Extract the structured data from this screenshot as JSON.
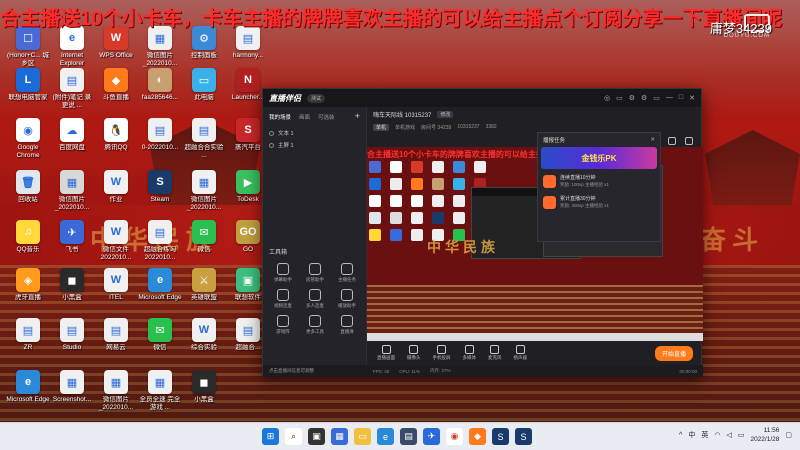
{
  "overlay": {
    "marquee": "合主播送10个小卡车，卡车主播的牌牌喜欢主播的可以给主播点个订阅分享一下直播间呢",
    "watermark": "庸梦34239",
    "brand": "DOUYU.COM"
  },
  "desktop": {
    "background_banner": "中华民族",
    "background_banner_right": "奋斗",
    "icons": [
      {
        "label": "(Honor+C... 城乡区",
        "color": "#4a6ad8",
        "glyph": "☐"
      },
      {
        "label": "Internet Explorer",
        "color": "#ffffff",
        "glyph": "e"
      },
      {
        "label": "WPS Office",
        "color": "#d83a2a",
        "glyph": "W"
      },
      {
        "label": "微信图片_2022010...",
        "color": "#f0f0f0",
        "glyph": "▦"
      },
      {
        "label": "控制面板",
        "color": "#3a8ad8",
        "glyph": "⚙"
      },
      {
        "label": "harmony...",
        "color": "#f0f0f0",
        "glyph": "▤"
      },
      {
        "label": "联想电脑管家",
        "color": "#1a6ad8",
        "glyph": "L"
      },
      {
        "label": "(附件)笔记 录 更说 ...",
        "color": "#f0f0f0",
        "glyph": "▤"
      },
      {
        "label": "斗鱼直播",
        "color": "#ff7a1a",
        "glyph": "◆"
      },
      {
        "label": "faa285646...",
        "color": "#c8a070",
        "glyph": "◐"
      },
      {
        "label": "此电脑",
        "color": "#3ab0e8",
        "glyph": "▭"
      },
      {
        "label": "Launcher...",
        "color": "#b02020",
        "glyph": "N"
      },
      {
        "label": "Google Chrome",
        "color": "#ffffff",
        "glyph": "◉"
      },
      {
        "label": "百度网盘",
        "color": "#ffffff",
        "glyph": "☁"
      },
      {
        "label": "腾讯QQ",
        "color": "#ffffff",
        "glyph": "🐧"
      },
      {
        "label": "0-2022010...",
        "color": "#f0f0f0",
        "glyph": "▤"
      },
      {
        "label": "超融合合实验 ...",
        "color": "#f0f0f0",
        "glyph": "▤"
      },
      {
        "label": "蒸汽平台",
        "color": "#c8282a",
        "glyph": "S"
      },
      {
        "label": "回收站",
        "color": "#e0e6ee",
        "glyph": "🗑"
      },
      {
        "label": "微信图片_2022010...",
        "color": "#d8d8d8",
        "glyph": "▦"
      },
      {
        "label": "作业",
        "color": "#f0f0f0",
        "glyph": "W"
      },
      {
        "label": "Steam",
        "color": "#1a3a6a",
        "glyph": "S"
      },
      {
        "label": "微信图片_2022010...",
        "color": "#f0f0f0",
        "glyph": "▦"
      },
      {
        "label": "ToDesk",
        "color": "#3ac060",
        "glyph": "▶"
      },
      {
        "label": "QQ音乐",
        "color": "#ffd83a",
        "glyph": "♫"
      },
      {
        "label": "飞书",
        "color": "#3a6ad8",
        "glyph": "✈"
      },
      {
        "label": "微信文件 2022010...",
        "color": "#f0f0f0",
        "glyph": "W"
      },
      {
        "label": "超融合练习 2022010...",
        "color": "#f0f0f0",
        "glyph": "▤"
      },
      {
        "label": "微信",
        "color": "#2ac050",
        "glyph": "✉"
      },
      {
        "label": "GO",
        "color": "#c0a040",
        "glyph": "GO"
      },
      {
        "label": "虎牙直播",
        "color": "#ff9a1a",
        "glyph": "◈"
      },
      {
        "label": "小黑盒",
        "color": "#2a2a2a",
        "glyph": "◼"
      },
      {
        "label": "ITEL",
        "color": "#f0f0f0",
        "glyph": "W"
      },
      {
        "label": "Microsoft Edge",
        "color": "#2a8ad8",
        "glyph": "e"
      },
      {
        "label": "英雄联盟",
        "color": "#c8a040",
        "glyph": "⚔"
      },
      {
        "label": "联想软件",
        "color": "#3ac080",
        "glyph": "▣"
      },
      {
        "label": "ZR",
        "color": "#f0f0f0",
        "glyph": "▤"
      },
      {
        "label": "Studio",
        "color": "#f0f0f0",
        "glyph": "▤"
      },
      {
        "label": "网易云",
        "color": "#f0f0f0",
        "glyph": "▤"
      },
      {
        "label": "微信",
        "color": "#2ac050",
        "glyph": "✉"
      },
      {
        "label": "综合实验",
        "color": "#f0f0f0",
        "glyph": "W"
      },
      {
        "label": "超融合...",
        "color": "#f0f0f0",
        "glyph": "▤"
      },
      {
        "label": "Microsoft Edge",
        "color": "#2a8ad8",
        "glyph": "e"
      },
      {
        "label": "Screenshot...",
        "color": "#f0f0f0",
        "glyph": "▦"
      },
      {
        "label": "微信图片_2022010...",
        "color": "#f0f0f0",
        "glyph": "▦"
      },
      {
        "label": "全员全速 完全游戏 ...",
        "color": "#f0f0f0",
        "glyph": "▦"
      },
      {
        "label": "小黑盒",
        "color": "#2a2a2a",
        "glyph": "◼"
      }
    ]
  },
  "app": {
    "brand": "直播伴侣",
    "version": "测试",
    "window_ctrls": [
      "◎",
      "▭",
      "⚙",
      "⚙",
      "▭",
      "—",
      "□",
      "✕"
    ],
    "left_tabs": [
      "我的场景",
      "画面",
      "可选装"
    ],
    "scenes": [
      "文本 1",
      "主屏 1"
    ],
    "tools_title": "工具箱",
    "tools": [
      "弹幕助手",
      "房管助手",
      "主播任务",
      "视频连麦",
      "多人连麦",
      "播放助手",
      "游戏阵",
      "更多工具",
      "直播清"
    ],
    "bottom_note": "点击直播间信息可调整",
    "stream_title": "嗨车天际线 10315237",
    "stream_tag": "修改",
    "stream_info": {
      "cat_badge": "单机",
      "category": "单机游戏",
      "room": "房间号 34239",
      "id": "10315237",
      "hot": "3382"
    },
    "preview_marquee": "合主播送10个小卡车的牌牌喜欢主播的可以给主播点个订阅分享一下直播间",
    "preview_banner": "中华民族",
    "controls": [
      "直播画面",
      "摄像头",
      "手机投屏",
      "多媒体",
      "麦克风",
      "扬声器"
    ],
    "live_button": "开始直播",
    "status": {
      "fps": "FPS: 30",
      "cpu": "CPU: 11%",
      "mem": "内存: 27%",
      "time": "00:00:00"
    }
  },
  "task_panel": {
    "title": "播报任务",
    "close": "✕",
    "banner": "金钱乐PK",
    "items": [
      {
        "title": "连续直播10分钟",
        "reward": "奖励: 100xp  主播经验 x1"
      },
      {
        "title": "累计直播30分钟",
        "reward": "奖励: 300xp  主播经验 x1"
      }
    ]
  },
  "taskbar": {
    "tray": {
      "chevron": "^",
      "lang": "中",
      "ime": "英",
      "time": "11:56",
      "date": "2022/1/28"
    }
  }
}
